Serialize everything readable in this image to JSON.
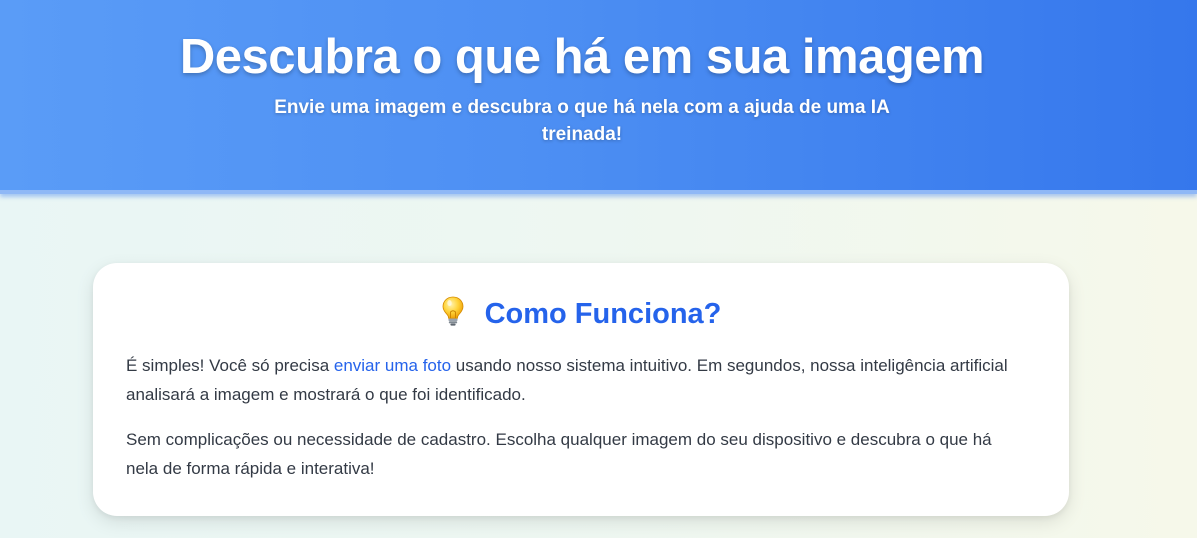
{
  "header": {
    "title": "Descubra o que há em sua imagem",
    "subtitle": "Envie uma imagem e descubra o que há nela com a ajuda de uma IA treinada!"
  },
  "how_it_works": {
    "icon": "lightbulb-icon",
    "heading": "Como Funciona?",
    "paragraph1": {
      "before_link": "É simples! Você só precisa ",
      "link_text": "enviar uma foto",
      "after_link": " usando nosso sistema intuitivo. Em segundos, nossa inteligência artificial analisará a imagem e mostrará o que foi identificado."
    },
    "paragraph2": "Sem complicações ou necessidade de cadastro. Escolha qualquer imagem do seu dispositivo e descubra o que há nela de forma rápida e interativa!"
  },
  "colors": {
    "header_start": "#5a9cf7",
    "header_end": "#3577ec",
    "accent": "#2563eb",
    "body_text": "#333a45"
  }
}
